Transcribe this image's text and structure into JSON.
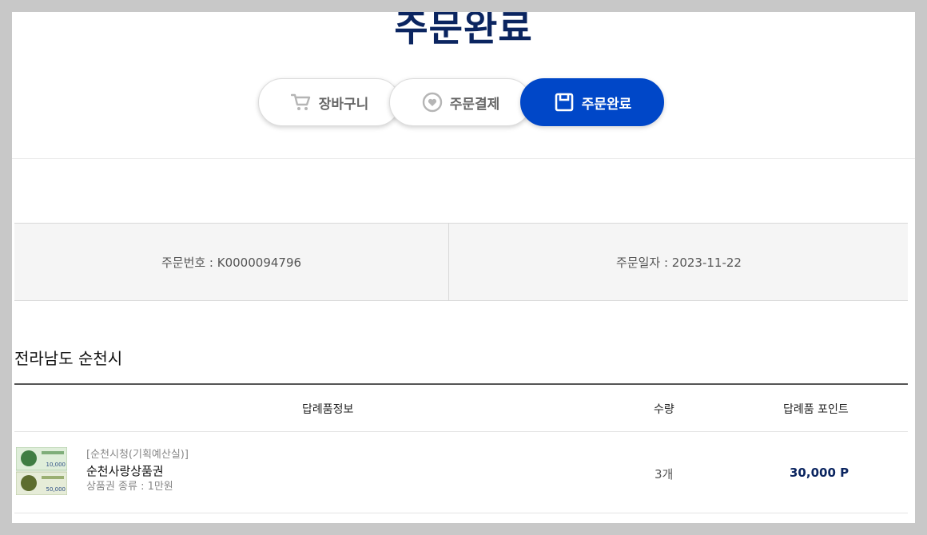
{
  "header": {
    "title": "주문완료"
  },
  "steps": {
    "cart": {
      "label": "장바구니",
      "icon": "cart-icon"
    },
    "payment": {
      "label": "주문결제",
      "icon": "heart-circle-icon"
    },
    "complete": {
      "label": "주문완료",
      "icon": "save-icon"
    }
  },
  "order": {
    "number_text": "주문번호 : K0000094796",
    "date_text": "주문일자 : 2023-11-22"
  },
  "region": {
    "title": "전라남도 순천시"
  },
  "product_table": {
    "columns": [
      "답례품정보",
      "수량",
      "답례품 포인트"
    ],
    "rows": [
      {
        "shop": "[순천시청(기획예산실)]",
        "name": "순천사랑상품권",
        "option": "상품권 종류 : 1만원",
        "qty": "3개",
        "point": "30,000 P",
        "thumb_top_value": "10,000",
        "thumb_bottom_value": "50,000"
      }
    ]
  },
  "colors": {
    "brand_navy": "#0b2560",
    "accent_blue": "#0047c8",
    "background_gray": "#c8c8c8"
  }
}
